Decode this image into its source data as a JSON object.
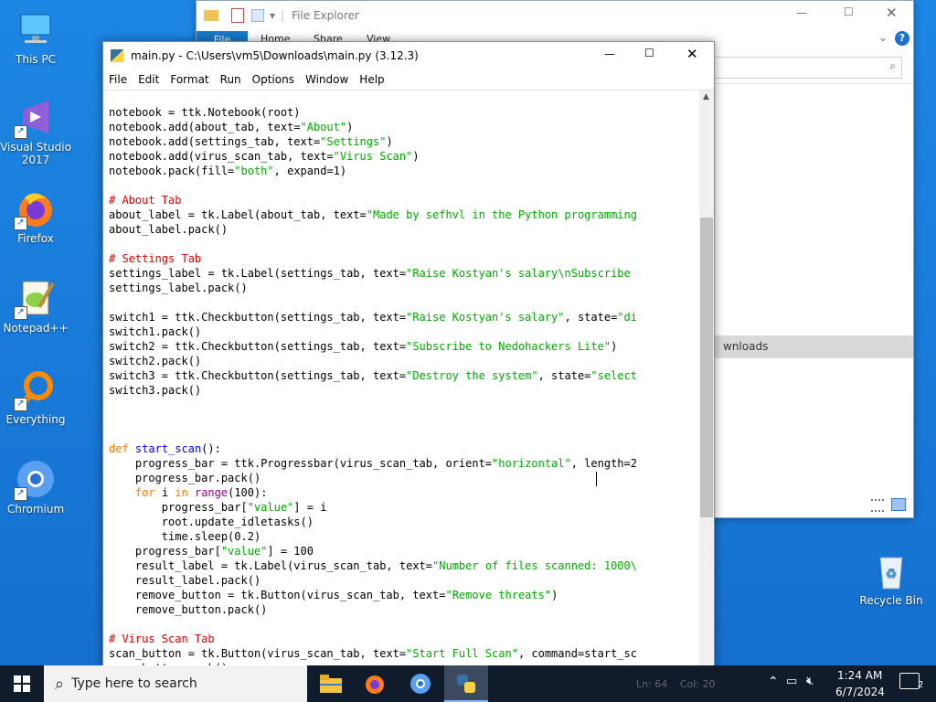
{
  "desktop": {
    "icons": [
      {
        "label": "This PC"
      },
      {
        "label": "Visual Studio 2017"
      },
      {
        "label": "Firefox"
      },
      {
        "label": "Notepad++"
      },
      {
        "label": "Everything"
      },
      {
        "label": "Chromium"
      },
      {
        "label": "Recycle Bin"
      }
    ]
  },
  "explorer": {
    "title": "File Explorer",
    "tabs": [
      "File",
      "Home",
      "Share",
      "View"
    ],
    "selected_row": "wnloads"
  },
  "editor": {
    "title": "main.py - C:\\Users\\vm5\\Downloads\\main.py (3.12.3)",
    "menu": [
      "File",
      "Edit",
      "Format",
      "Run",
      "Options",
      "Window",
      "Help"
    ],
    "status": {
      "ln": "Ln: 64",
      "col": "Col: 20"
    }
  },
  "taskbar": {
    "search_placeholder": "Type here to search",
    "clock_time": "1:24 AM",
    "clock_date": "6/7/2024",
    "notification_count": "2"
  }
}
